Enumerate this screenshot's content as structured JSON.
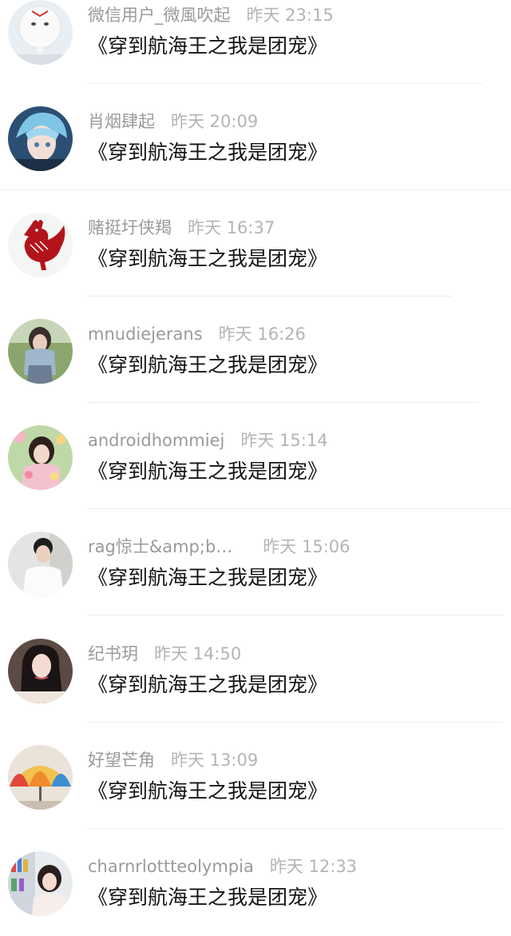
{
  "comments": [
    {
      "username": "微信用户_微風吹起",
      "time": "昨天 23:15",
      "message": "《穿到航海王之我是团宠》",
      "avatar_icon": "white-toy-figure-avatar-icon"
    },
    {
      "username": "肖烟肆起",
      "time": "昨天 20:09",
      "message": "《穿到航海王之我是团宠》",
      "avatar_icon": "anime-boy-blue-hair-avatar-icon"
    },
    {
      "username": "赌挺圩侠羯",
      "time": "昨天 16:37",
      "message": "《穿到航海王之我是团宠》",
      "avatar_icon": "red-papercut-rooster-avatar-icon"
    },
    {
      "username": "mnudiejerans",
      "time": "昨天 16:26",
      "message": "《穿到航海王之我是团宠》",
      "avatar_icon": "girl-outdoors-avatar-icon"
    },
    {
      "username": "androidhommiej",
      "time": "昨天 15:14",
      "message": "《穿到航海王之我是团宠》",
      "avatar_icon": "girl-with-flowers-avatar-icon"
    },
    {
      "username": "rag惊士&amp;b…",
      "time": "昨天 15:06",
      "message": "《穿到航海王之我是团宠》",
      "avatar_icon": "boy-white-shirt-avatar-icon"
    },
    {
      "username": "纪书玥",
      "time": "昨天 14:50",
      "message": "《穿到航海王之我是团宠》",
      "avatar_icon": "girl-long-hair-avatar-icon"
    },
    {
      "username": "好望芒角",
      "time": "昨天 13:09",
      "message": "《穿到航海王之我是团宠》",
      "avatar_icon": "rainbow-umbrella-avatar-icon"
    },
    {
      "username": "charnrlottteolympia",
      "time": "昨天 12:33",
      "message": "《穿到航海王之我是团宠》",
      "avatar_icon": "girl-bookshelf-avatar-icon"
    }
  ]
}
